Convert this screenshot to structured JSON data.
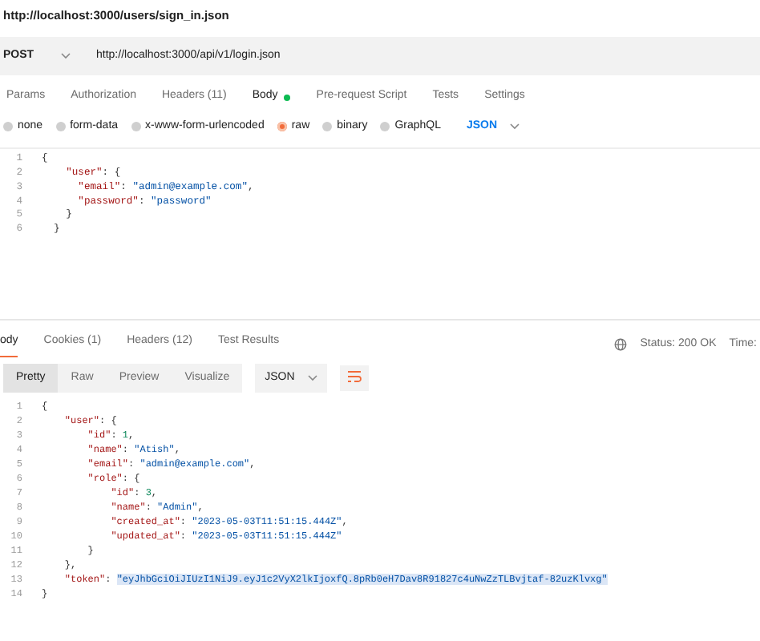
{
  "page_title": "http://localhost:3000/users/sign_in.json",
  "request": {
    "method": "POST",
    "url": "http://localhost:3000/api/v1/login.json"
  },
  "request_tabs": [
    {
      "label": "Params",
      "selected": false,
      "dot": false
    },
    {
      "label": "Authorization",
      "selected": false,
      "dot": false
    },
    {
      "label": "Headers (11)",
      "selected": false,
      "dot": false
    },
    {
      "label": "Body",
      "selected": true,
      "dot": true
    },
    {
      "label": "Pre-request Script",
      "selected": false,
      "dot": false
    },
    {
      "label": "Tests",
      "selected": false,
      "dot": false
    },
    {
      "label": "Settings",
      "selected": false,
      "dot": false
    }
  ],
  "body_types": [
    {
      "label": "none",
      "selected": false
    },
    {
      "label": "form-data",
      "selected": false
    },
    {
      "label": "x-www-form-urlencoded",
      "selected": false
    },
    {
      "label": "raw",
      "selected": true
    },
    {
      "label": "binary",
      "selected": false
    },
    {
      "label": "GraphQL",
      "selected": false
    }
  ],
  "body_format": "JSON",
  "request_body": [
    {
      "num": "1",
      "parts": [
        {
          "kind": "punct",
          "text": "{"
        }
      ]
    },
    {
      "num": "2",
      "parts": [
        {
          "kind": "key",
          "text": "    \"user\""
        },
        {
          "kind": "punct",
          "text": ": {"
        }
      ]
    },
    {
      "num": "3",
      "parts": [
        {
          "kind": "key",
          "text": "      \"email\""
        },
        {
          "kind": "punct",
          "text": ": "
        },
        {
          "kind": "string",
          "text": "\"admin@example.com\""
        },
        {
          "kind": "punct",
          "text": ","
        }
      ]
    },
    {
      "num": "4",
      "parts": [
        {
          "kind": "key",
          "text": "      \"password\""
        },
        {
          "kind": "punct",
          "text": ": "
        },
        {
          "kind": "string",
          "text": "\"password\""
        }
      ]
    },
    {
      "num": "5",
      "parts": [
        {
          "kind": "punct",
          "text": "    }"
        }
      ]
    },
    {
      "num": "6",
      "parts": [
        {
          "kind": "punct",
          "text": "  }"
        }
      ]
    }
  ],
  "response_tabs": [
    {
      "label": "ody",
      "selected": true
    },
    {
      "label": "Cookies (1)",
      "selected": false
    },
    {
      "label": "Headers (12)",
      "selected": false
    },
    {
      "label": "Test Results",
      "selected": false
    }
  ],
  "status": "Status: 200 OK",
  "time": "Time:",
  "view_modes": [
    {
      "label": "Pretty",
      "selected": true
    },
    {
      "label": "Raw",
      "selected": false
    },
    {
      "label": "Preview",
      "selected": false
    },
    {
      "label": "Visualize",
      "selected": false
    }
  ],
  "response_format": "JSON",
  "response_body": [
    {
      "num": "1",
      "parts": [
        {
          "kind": "punct",
          "text": "{"
        }
      ]
    },
    {
      "num": "2",
      "parts": [
        {
          "kind": "key",
          "text": "    \"user\""
        },
        {
          "kind": "punct",
          "text": ": {"
        }
      ]
    },
    {
      "num": "3",
      "parts": [
        {
          "kind": "key",
          "text": "        \"id\""
        },
        {
          "kind": "punct",
          "text": ": "
        },
        {
          "kind": "number",
          "text": "1"
        },
        {
          "kind": "punct",
          "text": ","
        }
      ]
    },
    {
      "num": "4",
      "parts": [
        {
          "kind": "key",
          "text": "        \"name\""
        },
        {
          "kind": "punct",
          "text": ": "
        },
        {
          "kind": "string",
          "text": "\"Atish\""
        },
        {
          "kind": "punct",
          "text": ","
        }
      ]
    },
    {
      "num": "5",
      "parts": [
        {
          "kind": "key",
          "text": "        \"email\""
        },
        {
          "kind": "punct",
          "text": ": "
        },
        {
          "kind": "string",
          "text": "\"admin@example.com\""
        },
        {
          "kind": "punct",
          "text": ","
        }
      ]
    },
    {
      "num": "6",
      "parts": [
        {
          "kind": "key",
          "text": "        \"role\""
        },
        {
          "kind": "punct",
          "text": ": {"
        }
      ]
    },
    {
      "num": "7",
      "parts": [
        {
          "kind": "key",
          "text": "            \"id\""
        },
        {
          "kind": "punct",
          "text": ": "
        },
        {
          "kind": "number",
          "text": "3"
        },
        {
          "kind": "punct",
          "text": ","
        }
      ]
    },
    {
      "num": "8",
      "parts": [
        {
          "kind": "key",
          "text": "            \"name\""
        },
        {
          "kind": "punct",
          "text": ": "
        },
        {
          "kind": "string",
          "text": "\"Admin\""
        },
        {
          "kind": "punct",
          "text": ","
        }
      ]
    },
    {
      "num": "9",
      "parts": [
        {
          "kind": "key",
          "text": "            \"created_at\""
        },
        {
          "kind": "punct",
          "text": ": "
        },
        {
          "kind": "string",
          "text": "\"2023-05-03T11:51:15.444Z\""
        },
        {
          "kind": "punct",
          "text": ","
        }
      ]
    },
    {
      "num": "10",
      "parts": [
        {
          "kind": "key",
          "text": "            \"updated_at\""
        },
        {
          "kind": "punct",
          "text": ": "
        },
        {
          "kind": "string",
          "text": "\"2023-05-03T11:51:15.444Z\""
        }
      ]
    },
    {
      "num": "11",
      "parts": [
        {
          "kind": "punct",
          "text": "        }"
        }
      ]
    },
    {
      "num": "12",
      "parts": [
        {
          "kind": "punct",
          "text": "    },"
        }
      ]
    },
    {
      "num": "13",
      "parts": [
        {
          "kind": "key",
          "text": "    \"token\""
        },
        {
          "kind": "punct",
          "text": ": "
        },
        {
          "kind": "selected-string",
          "text": "\"eyJhbGciOiJIUzI1NiJ9.eyJ1c2VyX2lkIjoxfQ.8pRb0eH7Dav8R91827c4uNwZzTLBvjtaf-82uzKlvxg\""
        }
      ]
    },
    {
      "num": "14",
      "parts": [
        {
          "kind": "punct",
          "text": "}"
        }
      ]
    }
  ]
}
